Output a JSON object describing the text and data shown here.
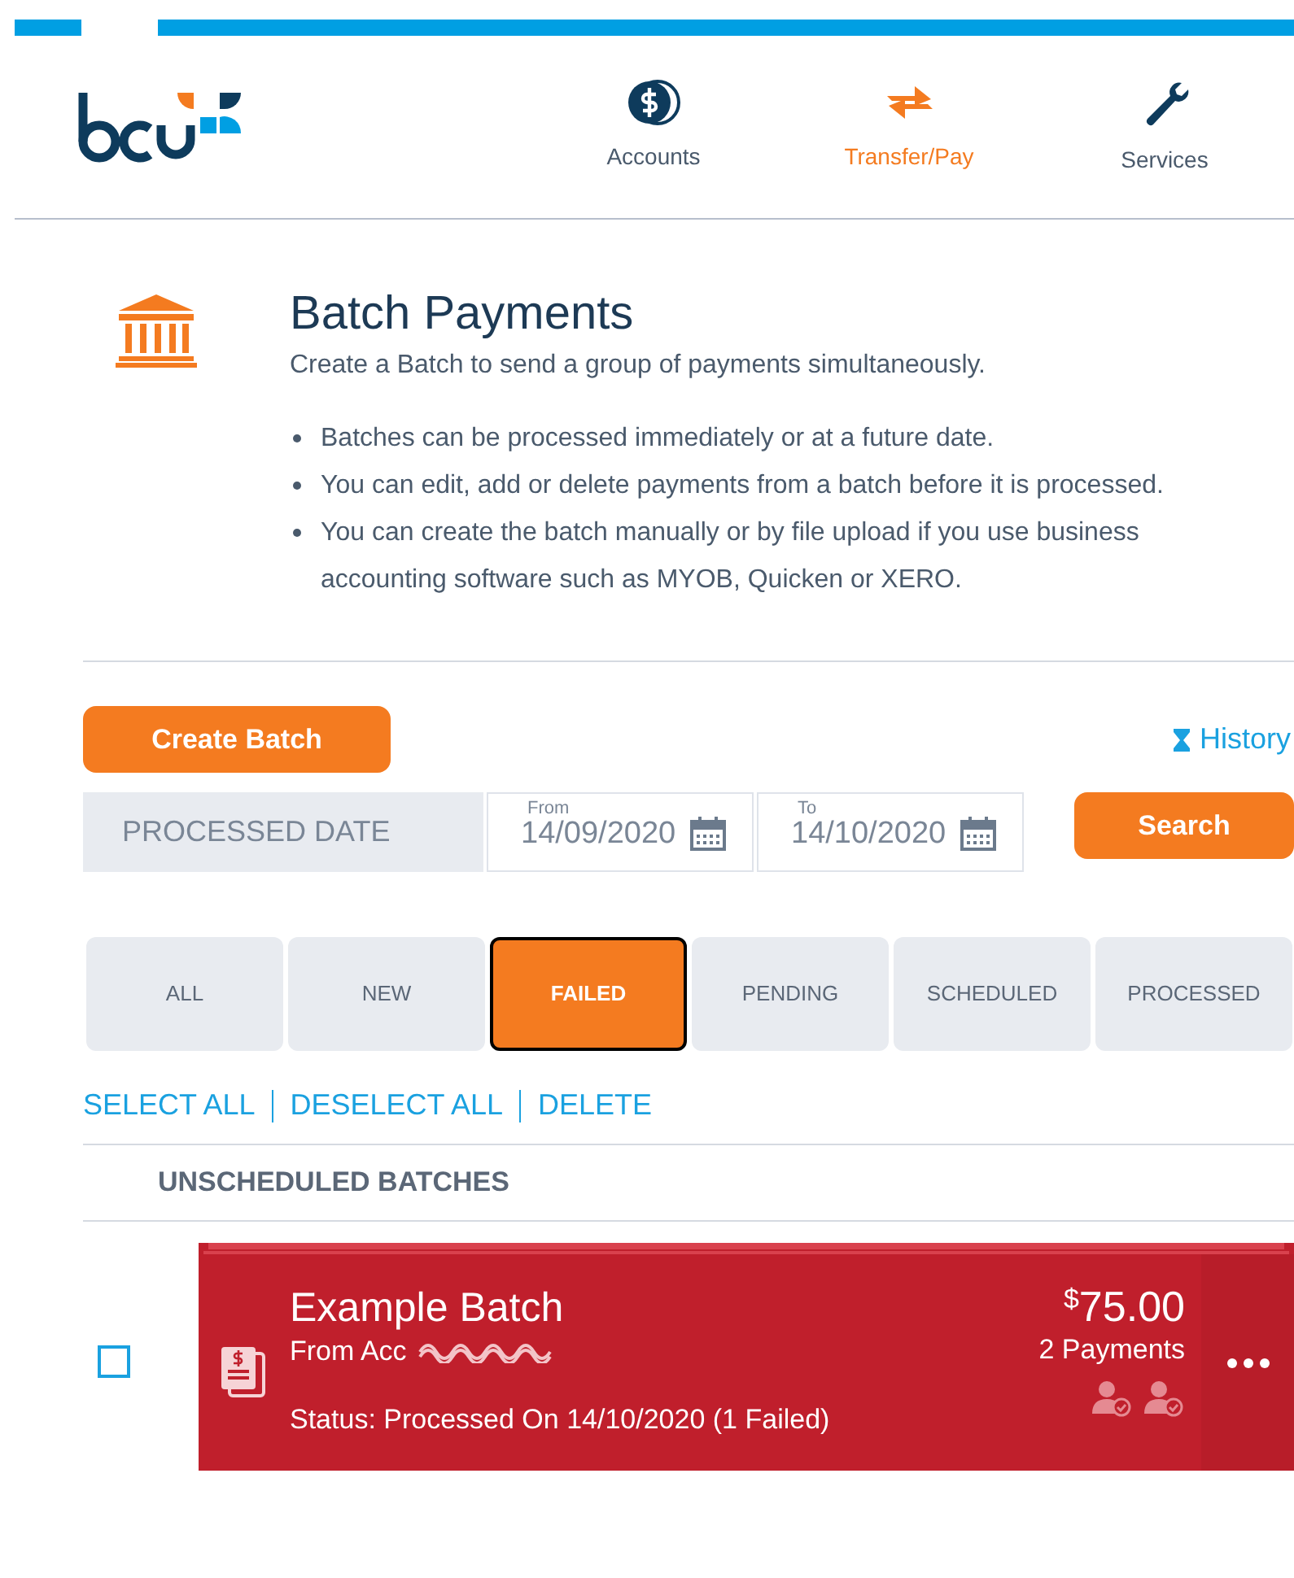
{
  "nav": [
    {
      "label": "Accounts",
      "kind": "coin",
      "selected": false
    },
    {
      "label": "Transfer/Pay",
      "kind": "transfer",
      "selected": true
    },
    {
      "label": "Services",
      "kind": "wrench",
      "selected": false
    }
  ],
  "page": {
    "title": "Batch Payments",
    "subtitle": "Create a Batch to send a group of payments simultaneously.",
    "bullets": [
      "Batches can be processed immediately or at a future date.",
      "You can edit, add or delete payments from a batch before it is processed.",
      "You can create the batch manually or by file upload if you use business accounting software such as MYOB, Quicken or XERO."
    ]
  },
  "create_button": "Create Batch",
  "history_link": "History",
  "filter": {
    "label": "PROCESSED DATE",
    "from_label": "From",
    "from_value": "14/09/2020",
    "to_label": "To",
    "to_value": "14/10/2020",
    "search_button": "Search"
  },
  "tabs": [
    {
      "label": "ALL",
      "selected": false
    },
    {
      "label": "NEW",
      "selected": false
    },
    {
      "label": "FAILED",
      "selected": true
    },
    {
      "label": "PENDING",
      "selected": false
    },
    {
      "label": "SCHEDULED",
      "selected": false
    },
    {
      "label": "PROCESSED",
      "selected": false
    }
  ],
  "actions": [
    "SELECT ALL",
    "DESELECT ALL",
    "DELETE"
  ],
  "section_title": "UNSCHEDULED BATCHES",
  "batches": [
    {
      "name": "Example Batch",
      "from": "From Acc",
      "status": "Status: Processed On 14/10/2020 (1 Failed)",
      "currency": "$",
      "amount": "75.00",
      "payments": "2 Payments",
      "checked": false,
      "color": "#c01f2c"
    }
  ]
}
